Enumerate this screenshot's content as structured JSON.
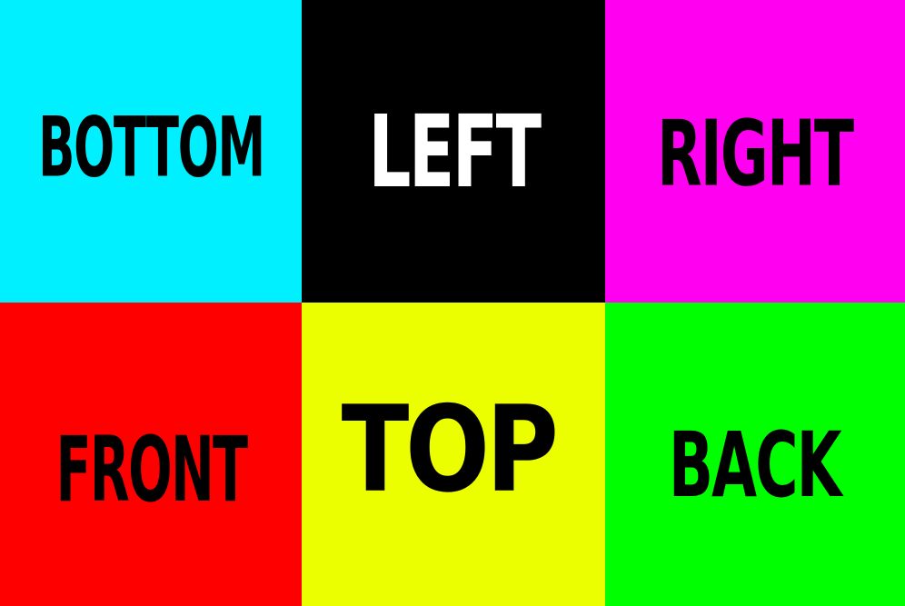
{
  "faces": [
    {
      "id": "bottom",
      "label": "BOTTOM",
      "background": "#00F0FF",
      "text_color": "#000000"
    },
    {
      "id": "left",
      "label": "LEFT",
      "background": "#000000",
      "text_color": "#FFFFFF"
    },
    {
      "id": "right",
      "label": "RIGHT",
      "background": "#FF00F0",
      "text_color": "#000000"
    },
    {
      "id": "front",
      "label": "FRONT",
      "background": "#FF0000",
      "text_color": "#000000"
    },
    {
      "id": "top",
      "label": "TOP",
      "background": "#EBFF00",
      "text_color": "#000000"
    },
    {
      "id": "back",
      "label": "BACK",
      "background": "#00FF00",
      "text_color": "#000000"
    }
  ]
}
